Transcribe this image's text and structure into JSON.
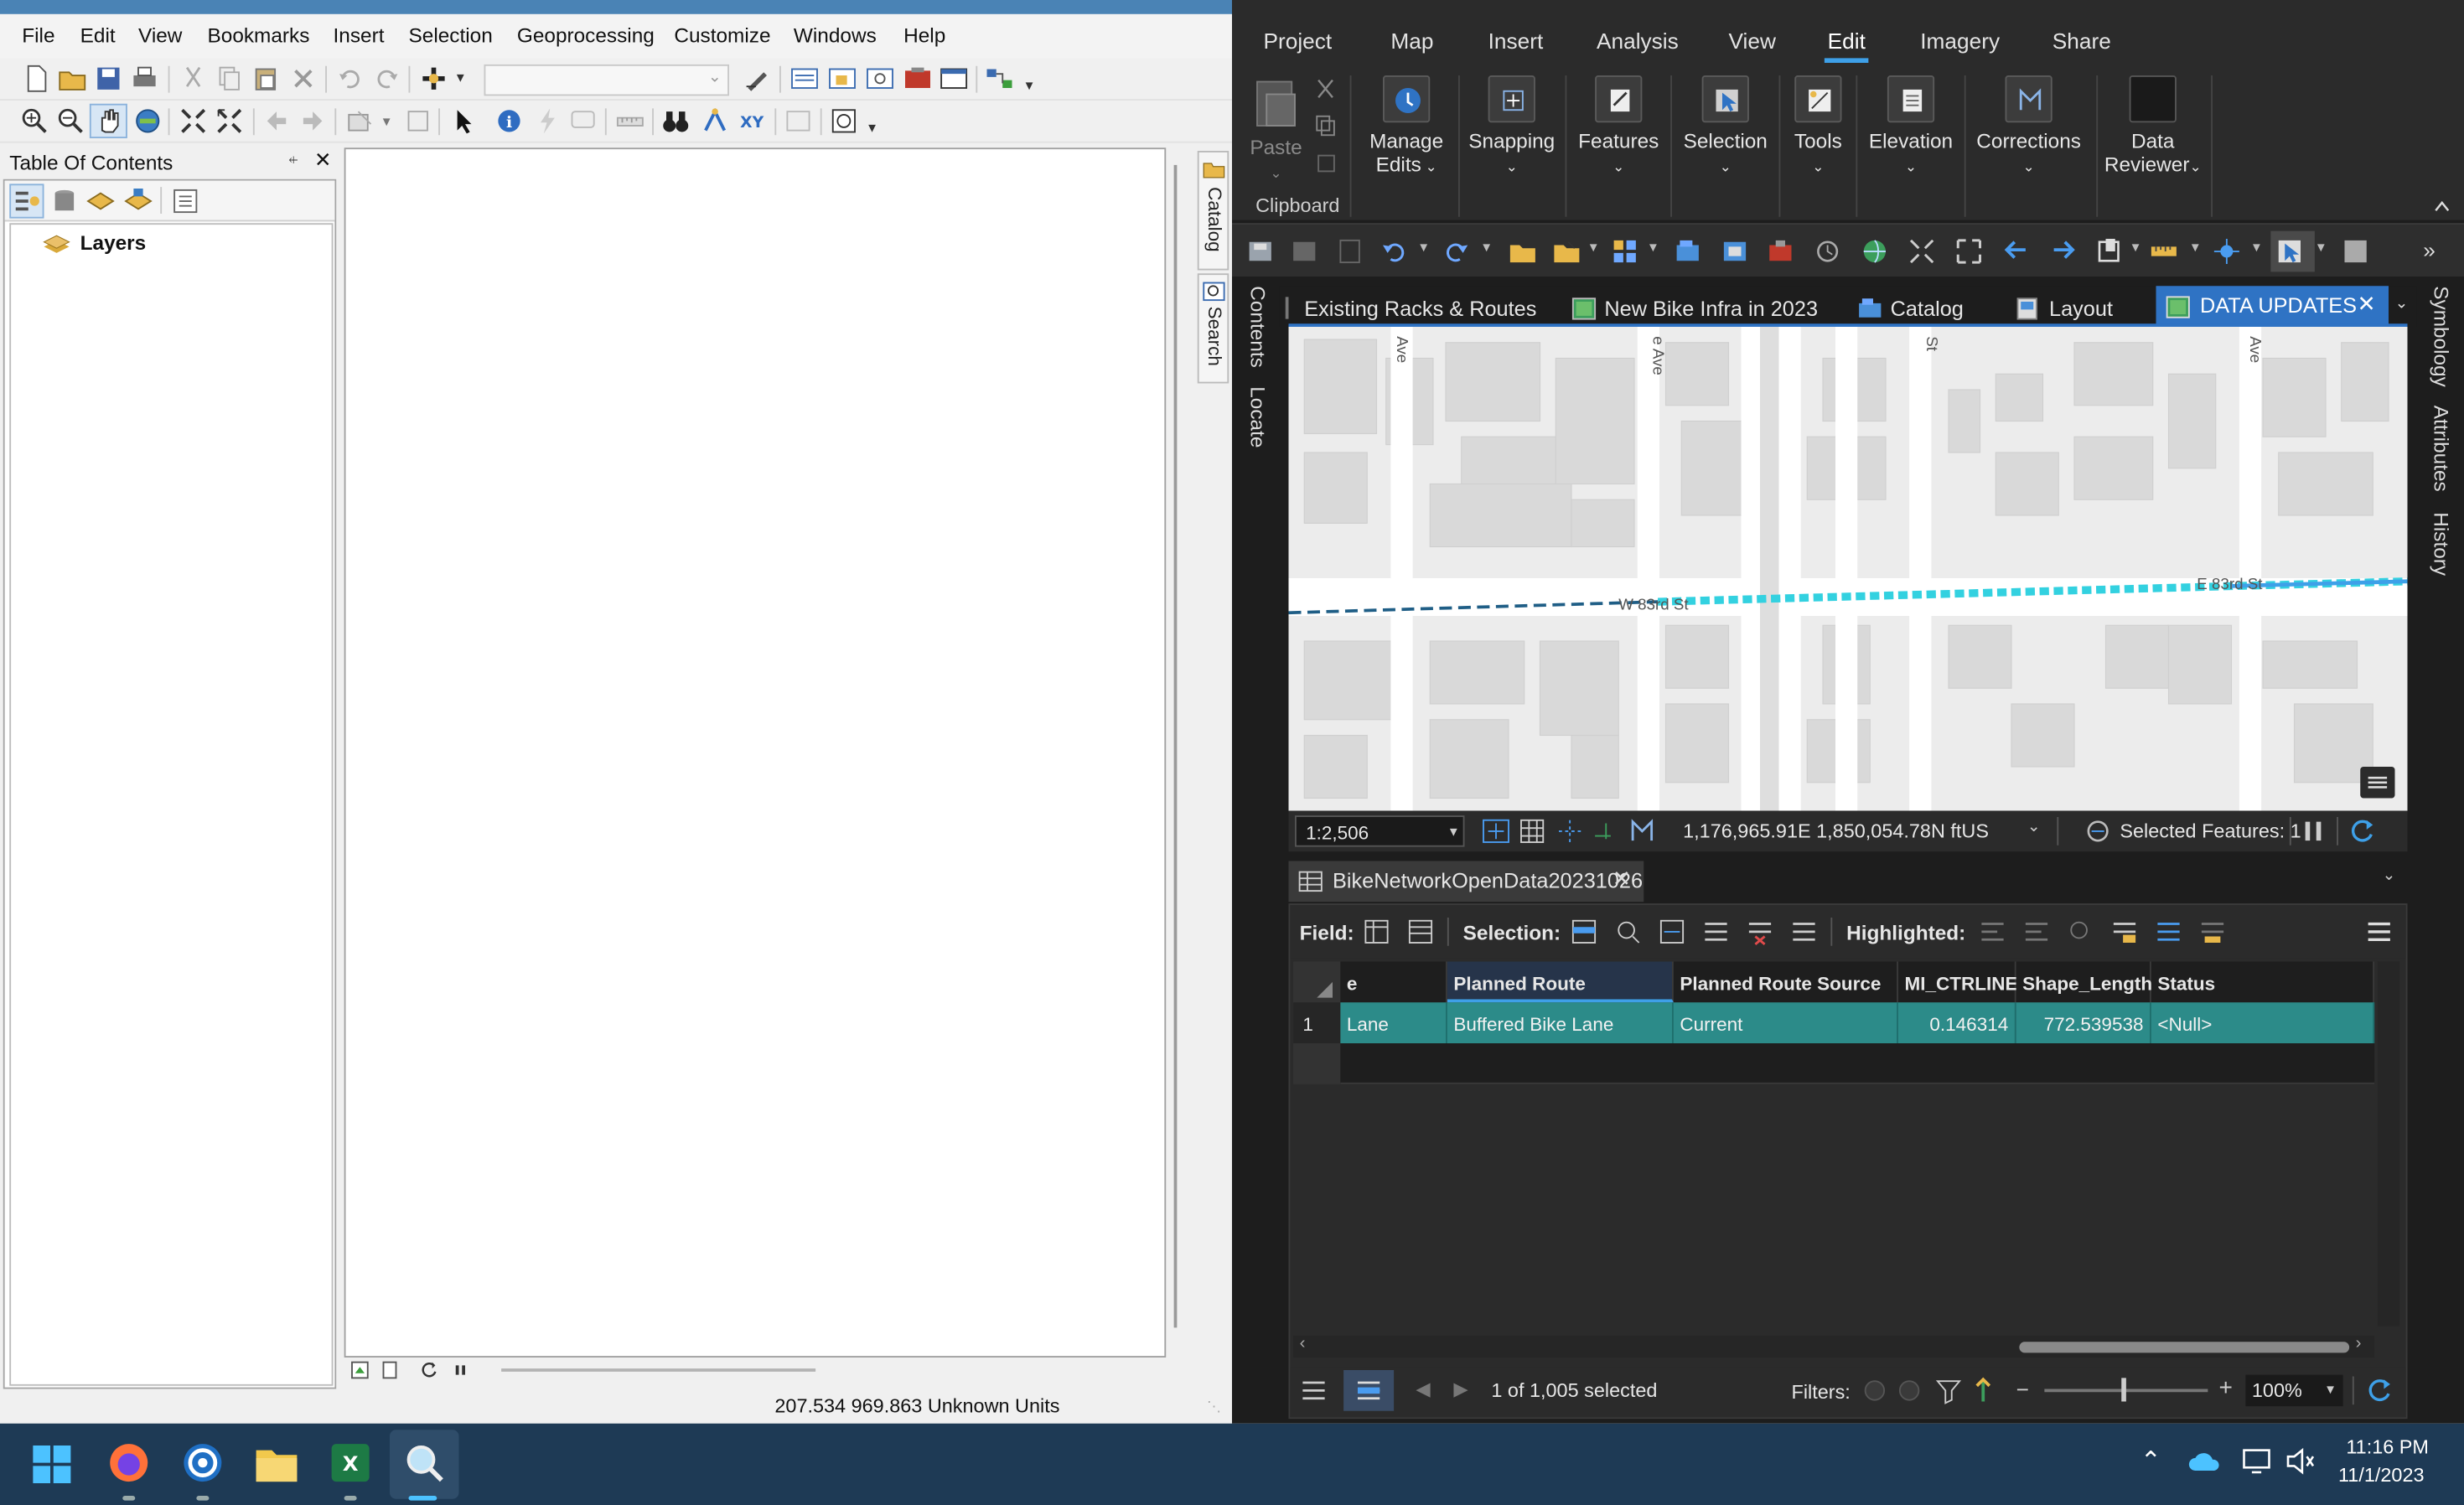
{
  "arcmap": {
    "menu": [
      "File",
      "Edit",
      "View",
      "Bookmarks",
      "Insert",
      "Selection",
      "Geoprocessing",
      "Customize",
      "Windows",
      "Help"
    ],
    "toc_title": "Table Of Contents",
    "toc_pin": "⍅",
    "toc_close": "✕",
    "layers_label": "Layers",
    "side_tabs": [
      "Catalog",
      "Search"
    ],
    "status_coords": "207.534  969.863 Unknown Units"
  },
  "pro": {
    "ribbon_tabs": [
      "Project",
      "Map",
      "Insert",
      "Analysis",
      "View",
      "Edit",
      "Imagery",
      "Share"
    ],
    "active_ribbon_tab": "Edit",
    "ribbon_buttons": {
      "paste": "Paste",
      "manage_edits": "Manage\nEdits",
      "snapping": "Snapping",
      "features": "Features",
      "selection": "Selection",
      "tools": "Tools",
      "elevation": "Elevation",
      "corrections": "Corrections",
      "data_reviewer": "Data\nReviewer"
    },
    "clipboard_group": "Clipboard",
    "view_tabs": [
      "Existing Racks & Routes",
      "New Bike Infra in 2023",
      "Catalog",
      "Layout",
      "DATA UPDATES"
    ],
    "left_side": [
      "Contents",
      "Locate"
    ],
    "right_side": [
      "Symbology",
      "Attributes",
      "History"
    ],
    "map": {
      "street_labels": [
        "Ave",
        "e Ave",
        "St",
        "Ave",
        "W 83rd St",
        "E 83rd St"
      ],
      "scale": "1:2,506",
      "coords": "1,176,965.91E 1,850,054.78N ftUS",
      "selected_features": "Selected Features: 1"
    },
    "table": {
      "tab_title": "BikeNetworkOpenData20231026",
      "field_label": "Field:",
      "selection_label": "Selection:",
      "highlighted_label": "Highlighted:",
      "columns": [
        "e",
        "Planned Route",
        "Planned Route Source",
        "MI_CTRLINE",
        "Shape_Length",
        "Status"
      ],
      "row": {
        "num": "1",
        "e": "Lane",
        "planned_route": "Buffered Bike Lane",
        "source": "Current",
        "mi": "0.146314",
        "shape": "772.539538",
        "status": "<Null>"
      },
      "footer_selected": "1 of 1,005 selected",
      "filters_label": "Filters:",
      "zoom": "100%"
    }
  },
  "taskbar": {
    "time": "11:16 PM",
    "date": "11/1/2023"
  },
  "colors": {
    "pro_bg": "#1d1d1d",
    "selection_teal": "#2c8b89",
    "accent_blue": "#3ea0e8",
    "route_cyan": "#33d1e0"
  }
}
